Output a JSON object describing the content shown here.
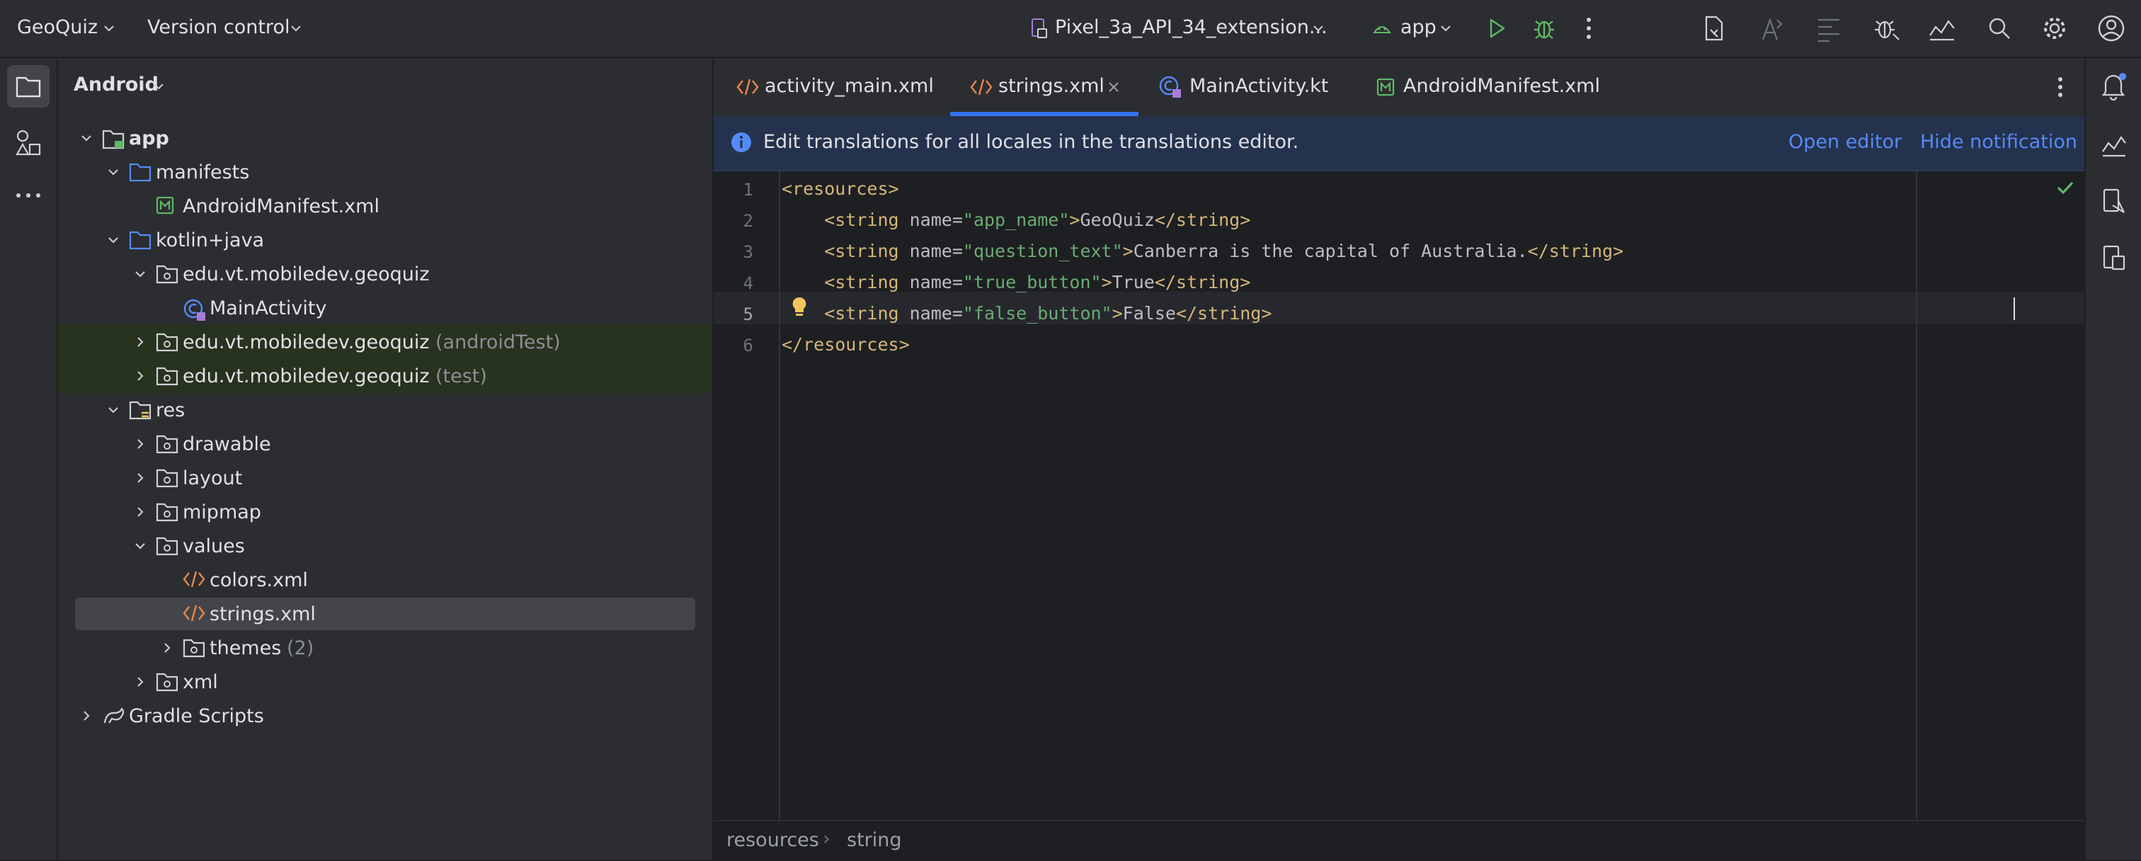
{
  "topbar": {
    "project_name": "GeoQuiz",
    "vcs_label": "Version control",
    "device": "Pixel_3a_API_34_extension...",
    "run_config": "app"
  },
  "project_panel": {
    "view_mode": "Android",
    "tree": [
      {
        "label": "app",
        "suffix": ""
      },
      {
        "label": "manifests",
        "suffix": ""
      },
      {
        "label": "AndroidManifest.xml",
        "suffix": ""
      },
      {
        "label": "kotlin+java",
        "suffix": ""
      },
      {
        "label": "edu.vt.mobiledev.geoquiz",
        "suffix": ""
      },
      {
        "label": "MainActivity",
        "suffix": ""
      },
      {
        "label": "edu.vt.mobiledev.geoquiz",
        "suffix": "(androidTest)"
      },
      {
        "label": "edu.vt.mobiledev.geoquiz",
        "suffix": "(test)"
      },
      {
        "label": "res",
        "suffix": ""
      },
      {
        "label": "drawable",
        "suffix": ""
      },
      {
        "label": "layout",
        "suffix": ""
      },
      {
        "label": "mipmap",
        "suffix": ""
      },
      {
        "label": "values",
        "suffix": ""
      },
      {
        "label": "colors.xml",
        "suffix": ""
      },
      {
        "label": "strings.xml",
        "suffix": ""
      },
      {
        "label": "themes",
        "suffix": "(2)"
      },
      {
        "label": "xml",
        "suffix": ""
      },
      {
        "label": "Gradle Scripts",
        "suffix": ""
      }
    ]
  },
  "tabs": [
    {
      "label": "activity_main.xml"
    },
    {
      "label": "strings.xml"
    },
    {
      "label": "MainActivity.kt"
    },
    {
      "label": "AndroidManifest.xml"
    }
  ],
  "notification": {
    "message": "Edit translations for all locales in the translations editor.",
    "open_editor": "Open editor",
    "hide": "Hide notification"
  },
  "editor": {
    "line_numbers": [
      "1",
      "2",
      "3",
      "4",
      "5",
      "6"
    ],
    "lines": [
      [
        {
          "t": "tag",
          "v": "<resources>"
        }
      ],
      [
        {
          "t": "tag",
          "v": "    <string "
        },
        {
          "t": "attr",
          "v": "name="
        },
        {
          "t": "val",
          "v": "\"app_name\""
        },
        {
          "t": "tag",
          "v": ">"
        },
        {
          "t": "txt",
          "v": "GeoQuiz"
        },
        {
          "t": "tag",
          "v": "</string>"
        }
      ],
      [
        {
          "t": "tag",
          "v": "    <string "
        },
        {
          "t": "attr",
          "v": "name="
        },
        {
          "t": "val",
          "v": "\"question_text\""
        },
        {
          "t": "tag",
          "v": ">"
        },
        {
          "t": "txt",
          "v": "Canberra is the capital of Australia."
        },
        {
          "t": "tag",
          "v": "</string>"
        }
      ],
      [
        {
          "t": "tag",
          "v": "    <string "
        },
        {
          "t": "attr",
          "v": "name="
        },
        {
          "t": "val",
          "v": "\"true_button\""
        },
        {
          "t": "tag",
          "v": ">"
        },
        {
          "t": "txt",
          "v": "True"
        },
        {
          "t": "tag",
          "v": "</string>"
        }
      ],
      [
        {
          "t": "tag",
          "v": "    <string "
        },
        {
          "t": "attr",
          "v": "name="
        },
        {
          "t": "val",
          "v": "\"false_button\""
        },
        {
          "t": "tag",
          "v": ">"
        },
        {
          "t": "txt",
          "v": "False"
        },
        {
          "t": "tag",
          "v": "</string>"
        }
      ],
      [
        {
          "t": "tag",
          "v": "</resources>"
        }
      ]
    ]
  },
  "breadcrumbs": {
    "items": [
      "resources",
      "string"
    ],
    "separator": "›"
  },
  "colors": {
    "accent": "#3574f0",
    "link": "#548af7",
    "run_green": "#5fb865",
    "selected_row": "#43454a",
    "test_row": "#27321f"
  }
}
